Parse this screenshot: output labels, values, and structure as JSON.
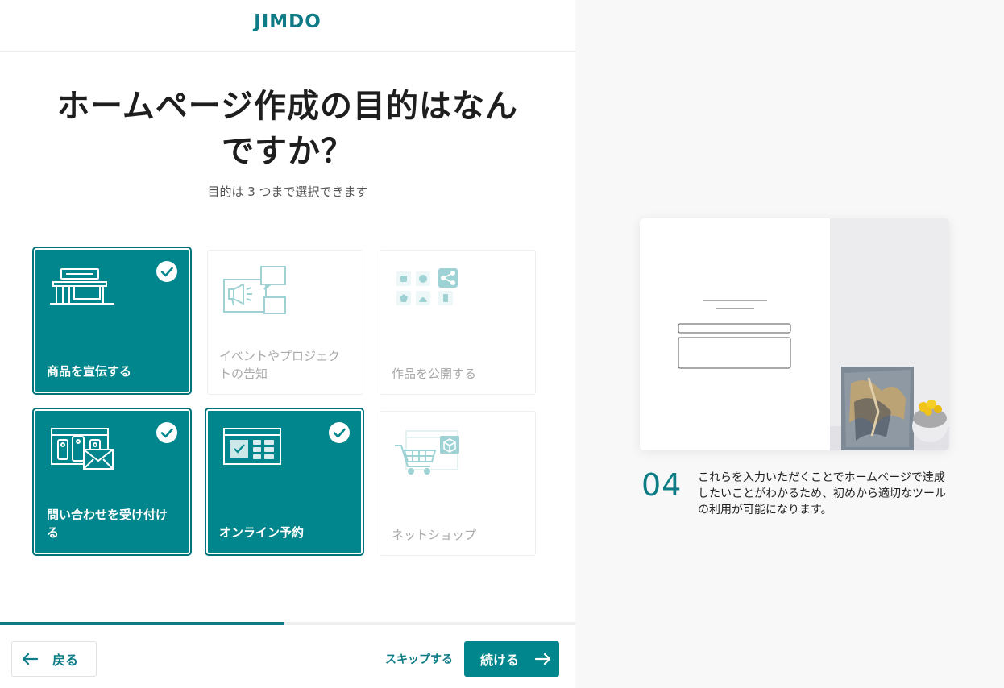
{
  "header": {
    "logo": "JIMDO"
  },
  "question": {
    "title": "ホームページ作成の目的はなんですか？",
    "subtitle": "目的は 3 つまで選択できます"
  },
  "options": [
    {
      "label": "商品を宣伝する",
      "selected": true,
      "icon": "storefront-icon"
    },
    {
      "label": "イベントやプロジェクトの告知",
      "selected": false,
      "icon": "megaphone-icon"
    },
    {
      "label": "作品を公開する",
      "selected": false,
      "icon": "share-shapes-icon"
    },
    {
      "label": "問い合わせを受け付ける",
      "selected": true,
      "icon": "contact-mail-icon"
    },
    {
      "label": "オンライン予約",
      "selected": true,
      "icon": "calendar-booking-icon"
    },
    {
      "label": "ネットショップ",
      "selected": false,
      "icon": "shopping-cart-icon"
    }
  ],
  "progress": {
    "fraction": 0.495
  },
  "footer": {
    "back_label": "戻る",
    "skip_label": "スキップする",
    "next_label": "続ける"
  },
  "info": {
    "step_number": "04",
    "text": "これらを入力いただくことでホームページで達成したいことがわかるため、初めから適切なツールの利用が可能になります。"
  },
  "colors": {
    "accent": "#00868c",
    "brand": "#0e7c86",
    "side_background": "#f8f8f8"
  }
}
